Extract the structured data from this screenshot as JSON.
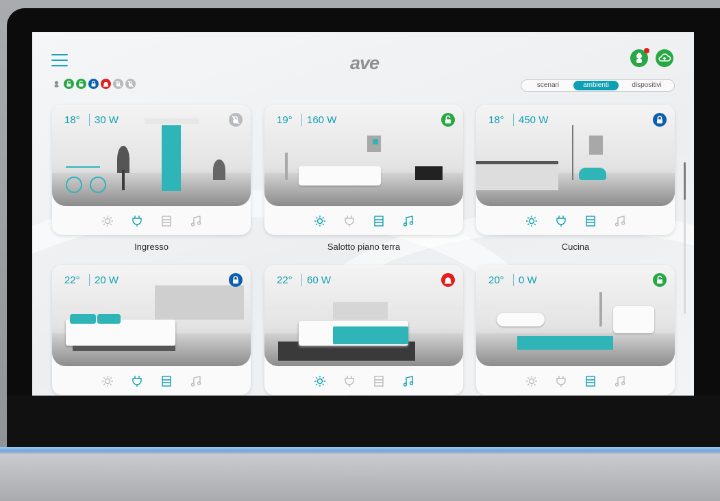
{
  "header": {
    "logo": "ave",
    "tabs": [
      {
        "label": "scenari",
        "active": false
      },
      {
        "label": "ambienti",
        "active": true
      },
      {
        "label": "dispositivi",
        "active": false
      }
    ]
  },
  "status_icons": [
    {
      "icon": "technician-icon",
      "color": "#8d8f92"
    },
    {
      "icon": "lock-open-icon",
      "color": "#28a745"
    },
    {
      "icon": "lock-open-alert-icon",
      "color": "#28a745"
    },
    {
      "icon": "lock-closed-icon",
      "color": "#0a5fb0"
    },
    {
      "icon": "alarm-icon",
      "color": "#e02020"
    },
    {
      "icon": "lock-disabled-icon",
      "color": "#b9babc"
    },
    {
      "icon": "lock-disabled-icon",
      "color": "#b9babc"
    }
  ],
  "rooms": [
    {
      "name": "Ingresso",
      "temp": "18°",
      "power": "30 W",
      "lock": "lock-disabled-icon",
      "lock_color": "#b9babc",
      "features": {
        "light": false,
        "power": true,
        "shutter": false,
        "music": false
      }
    },
    {
      "name": "Salotto piano terra",
      "temp": "19°",
      "power": "160 W",
      "lock": "lock-open-icon",
      "lock_color": "#28a745",
      "features": {
        "light": true,
        "power": false,
        "shutter": true,
        "music": true
      }
    },
    {
      "name": "Cucina",
      "temp": "18°",
      "power": "450 W",
      "lock": "lock-closed-icon",
      "lock_color": "#0a5fb0",
      "features": {
        "light": true,
        "power": true,
        "shutter": true,
        "music": false
      }
    },
    {
      "name": "",
      "temp": "22°",
      "power": "20 W",
      "lock": "lock-closed-icon",
      "lock_color": "#0a5fb0",
      "features": {
        "light": false,
        "power": true,
        "shutter": true,
        "music": false
      }
    },
    {
      "name": "",
      "temp": "22°",
      "power": "60 W",
      "lock": "alarm-icon",
      "lock_color": "#e02020",
      "features": {
        "light": true,
        "power": false,
        "shutter": false,
        "music": true
      }
    },
    {
      "name": "",
      "temp": "20°",
      "power": "0 W",
      "lock": "lock-open-icon",
      "lock_color": "#28a745",
      "features": {
        "light": false,
        "power": false,
        "shutter": true,
        "music": false
      }
    }
  ],
  "colors": {
    "accent": "#0f9fb2",
    "inactive": "#b9babc"
  }
}
